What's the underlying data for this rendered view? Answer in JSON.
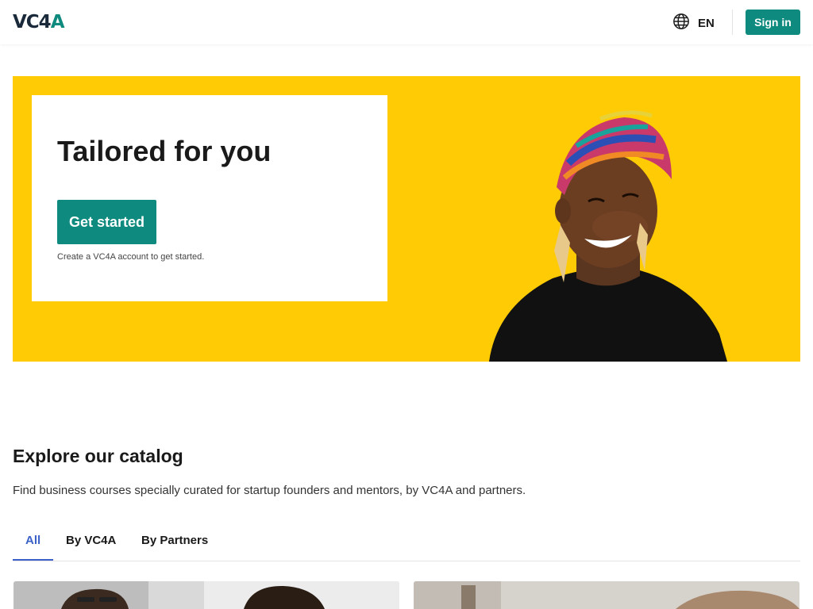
{
  "header": {
    "logo": {
      "main": "VC4",
      "accent": "A"
    },
    "language": {
      "label": "EN",
      "icon": "globe-icon"
    },
    "signin_label": "Sign in"
  },
  "hero": {
    "title": "Tailored for you",
    "cta_label": "Get started",
    "cta_note": "Create a VC4A account to get started.",
    "background_color": "#ffcb05"
  },
  "catalog": {
    "title": "Explore our catalog",
    "description": "Find business courses specially curated for startup founders and mentors, by VC4A and partners.",
    "tabs": [
      {
        "label": "All",
        "active": true
      },
      {
        "label": "By VC4A",
        "active": false
      },
      {
        "label": "By Partners",
        "active": false
      }
    ]
  },
  "colors": {
    "brand": "#0e8a7e",
    "tab_active": "#3c62c9"
  }
}
